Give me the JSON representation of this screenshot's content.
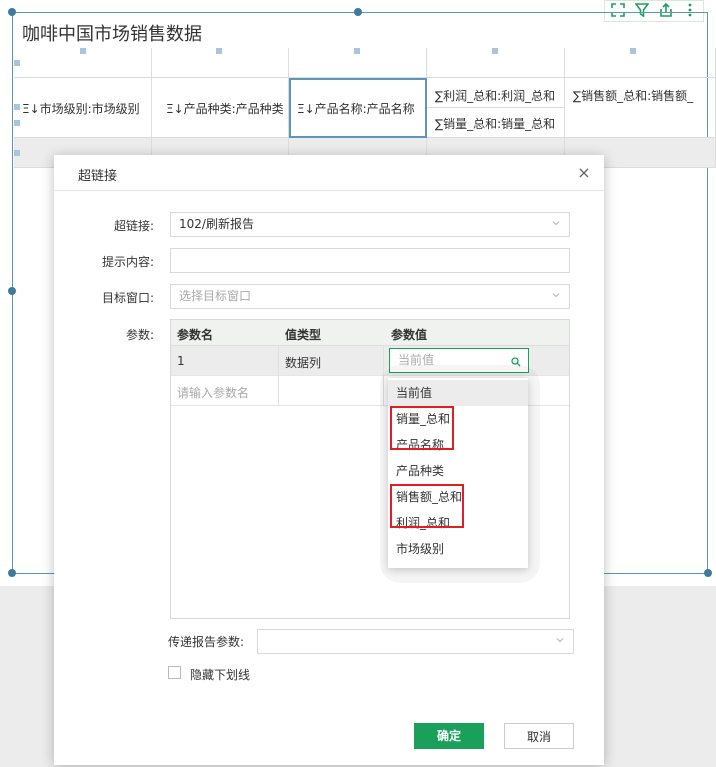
{
  "report": {
    "title": "咖啡中国市场销售数据",
    "columns": [
      "Ξ↓市场级别:市场级别",
      "Ξ↓产品种类:产品种类",
      "Ξ↓产品名称:产品名称",
      "∑利润_总和:利润_总和",
      "∑销售额_总和:销售额_"
    ],
    "subcolumn": "∑销量_总和:销量_总和"
  },
  "toolbar": {
    "icons": [
      "expand-icon",
      "filter-icon",
      "export-icon",
      "more-icon"
    ]
  },
  "modal": {
    "title": "超链接",
    "close": "×",
    "hyperlink_label": "超链接:",
    "hyperlink_value": "102/刷新报告",
    "tip_label": "提示内容:",
    "tip_value": "",
    "target_label": "目标窗口:",
    "target_placeholder": "选择目标窗口",
    "params_label": "参数:",
    "params_headers": [
      "参数名",
      "值类型",
      "参数值"
    ],
    "params_rows": [
      {
        "name": "1",
        "type": "数据列",
        "value_placeholder": "当前值"
      }
    ],
    "new_param_placeholder": "请输入参数名",
    "dropdown_items": [
      "当前值",
      "销量_总和",
      "产品名称",
      "产品种类",
      "销售额_总和",
      "利润_总和",
      "市场级别"
    ],
    "pass_params_label": "传递报告参数:",
    "hide_underline_label": "隐藏下划线",
    "ok_label": "确定",
    "cancel_label": "取消"
  },
  "colors": {
    "accent": "#1aa05a",
    "highlight_box": "#e02020",
    "selection": "#5e95b8"
  }
}
